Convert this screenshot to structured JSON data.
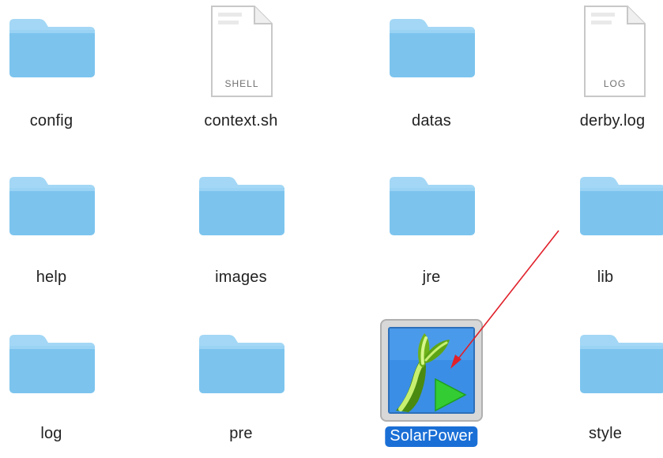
{
  "files": [
    {
      "name": "config",
      "kind": "folder"
    },
    {
      "name": "context.sh",
      "kind": "document",
      "badge": "SHELL"
    },
    {
      "name": "datas",
      "kind": "folder"
    },
    {
      "name": "derby.log",
      "kind": "document",
      "badge": "LOG"
    },
    {
      "name": "help",
      "kind": "folder"
    },
    {
      "name": "images",
      "kind": "folder"
    },
    {
      "name": "jre",
      "kind": "folder"
    },
    {
      "name": "lib",
      "kind": "folder"
    },
    {
      "name": "log",
      "kind": "folder"
    },
    {
      "name": "pre",
      "kind": "folder"
    },
    {
      "name": "SolarPower",
      "kind": "application",
      "selected": true
    },
    {
      "name": "style",
      "kind": "folder"
    }
  ],
  "colors": {
    "folder": "#7cc4ee",
    "folder_tab": "#a3d7f5",
    "selection": "#1a6fd6",
    "annotation_arrow": "#e0202a",
    "app_background": "#3a8ee6",
    "app_play": "#33cc33"
  },
  "icons": {
    "folder": "folder-icon",
    "document": "document-icon",
    "application": "solarpower-app-icon"
  }
}
